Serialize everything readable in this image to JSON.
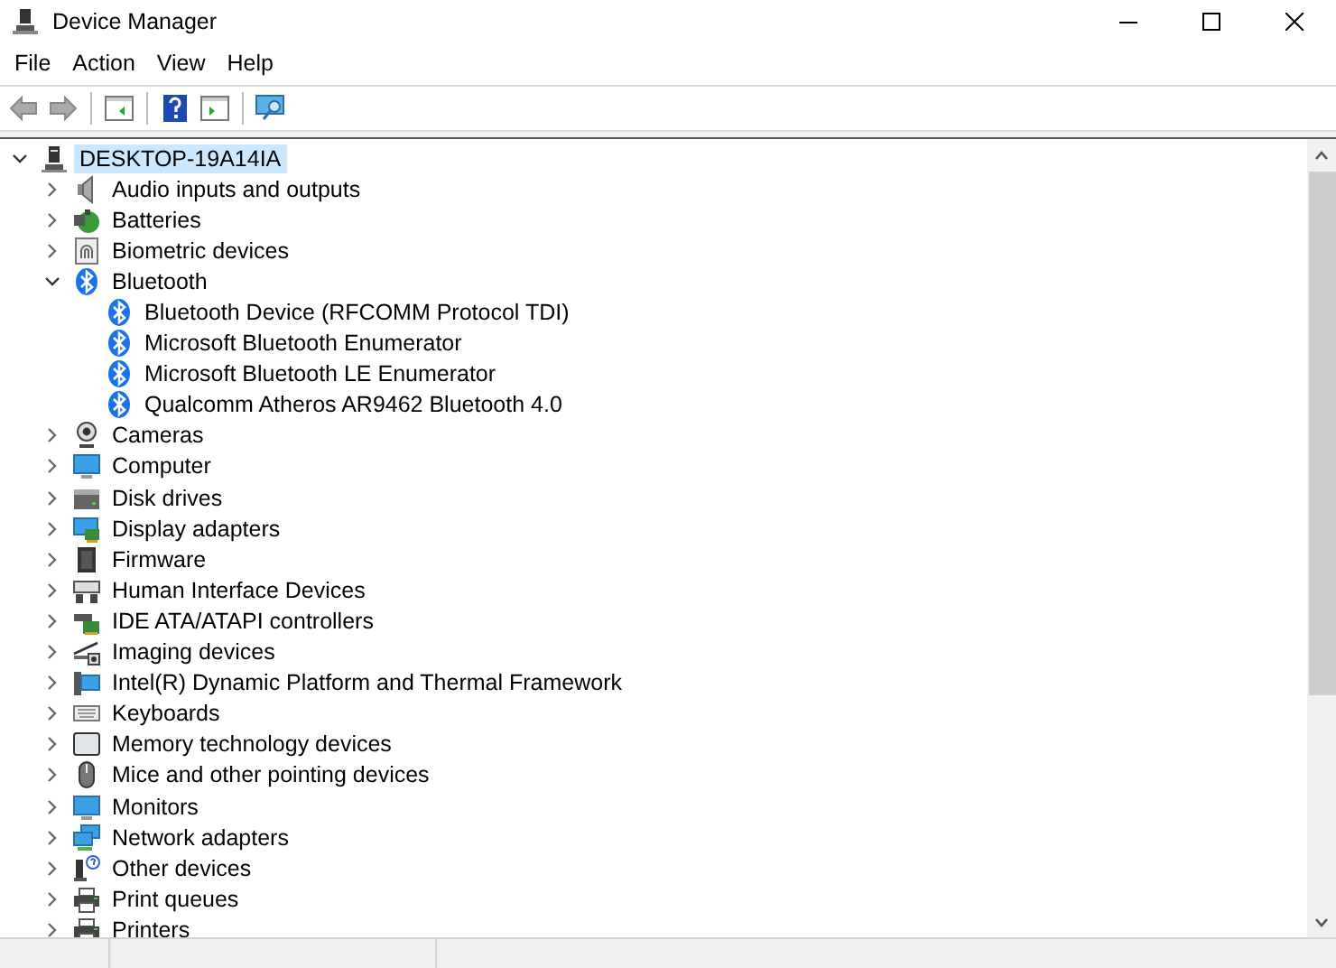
{
  "window": {
    "title": "Device Manager"
  },
  "menu": [
    "File",
    "Action",
    "View",
    "Help"
  ],
  "tree": [
    {
      "label": "DESKTOP-19A14IA",
      "kind": "pc",
      "expanded": true,
      "selected": true,
      "children": [
        {
          "label": "Audio inputs and outputs",
          "kind": "speaker",
          "expanded": false,
          "selected": false
        },
        {
          "label": "Batteries",
          "kind": "battery",
          "expanded": false,
          "selected": false
        },
        {
          "label": "Biometric devices",
          "kind": "fingerprint",
          "expanded": false,
          "selected": false
        },
        {
          "label": "Bluetooth",
          "kind": "bluetooth",
          "expanded": true,
          "selected": false,
          "children": [
            {
              "label": "Bluetooth Device (RFCOMM Protocol TDI)",
              "kind": "bluetooth",
              "selected": false
            },
            {
              "label": "Microsoft Bluetooth Enumerator",
              "kind": "bluetooth",
              "selected": false
            },
            {
              "label": "Microsoft Bluetooth LE Enumerator",
              "kind": "bluetooth",
              "selected": false
            },
            {
              "label": "Qualcomm Atheros AR9462 Bluetooth 4.0",
              "kind": "bluetooth",
              "selected": false
            }
          ]
        },
        {
          "label": "Cameras",
          "kind": "camera",
          "expanded": false,
          "selected": false
        },
        {
          "label": "Computer",
          "kind": "monitor",
          "expanded": false,
          "selected": false
        },
        {
          "label": "Disk drives",
          "kind": "disk",
          "expanded": false,
          "selected": false
        },
        {
          "label": "Display adapters",
          "kind": "adapter",
          "expanded": false,
          "selected": false
        },
        {
          "label": "Firmware",
          "kind": "chip",
          "expanded": false,
          "selected": false
        },
        {
          "label": "Human Interface Devices",
          "kind": "hid",
          "expanded": false,
          "selected": false
        },
        {
          "label": "IDE ATA/ATAPI controllers",
          "kind": "controller",
          "expanded": false,
          "selected": false
        },
        {
          "label": "Imaging devices",
          "kind": "scanner",
          "expanded": false,
          "selected": false
        },
        {
          "label": "Intel(R) Dynamic Platform and Thermal Framework",
          "kind": "system",
          "expanded": false,
          "selected": false
        },
        {
          "label": "Keyboards",
          "kind": "keyboard",
          "expanded": false,
          "selected": false
        },
        {
          "label": "Memory technology devices",
          "kind": "memory",
          "expanded": false,
          "selected": false
        },
        {
          "label": "Mice and other pointing devices",
          "kind": "mouse",
          "expanded": false,
          "selected": false
        },
        {
          "label": "Monitors",
          "kind": "monitor",
          "expanded": false,
          "selected": false
        },
        {
          "label": "Network adapters",
          "kind": "network",
          "expanded": false,
          "selected": false
        },
        {
          "label": "Other devices",
          "kind": "unknown",
          "expanded": false,
          "selected": false
        },
        {
          "label": "Print queues",
          "kind": "printer",
          "expanded": false,
          "selected": false
        },
        {
          "label": "Printers",
          "kind": "printer",
          "expanded": false,
          "selected": false
        }
      ]
    }
  ]
}
